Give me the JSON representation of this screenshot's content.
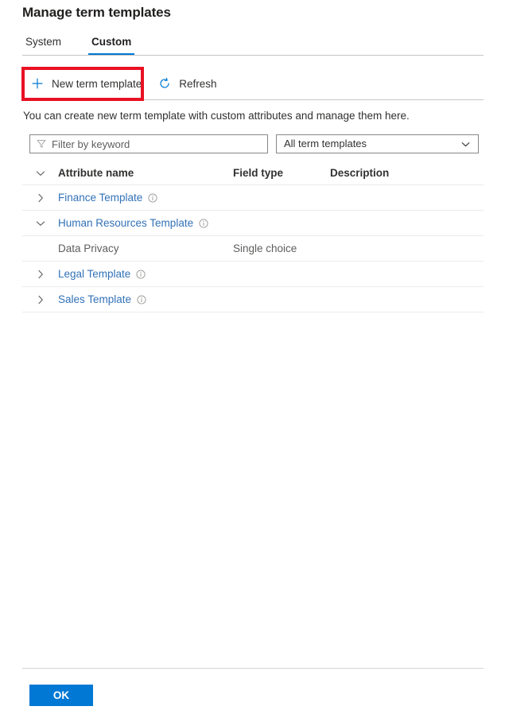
{
  "header": {
    "title": "Manage term templates"
  },
  "tabs": [
    {
      "label": "System",
      "active": false,
      "name": "tab-system"
    },
    {
      "label": "Custom",
      "active": true,
      "name": "tab-custom"
    }
  ],
  "commandbar": {
    "new_template_label": "New term template",
    "new_template_icon": "plus-icon",
    "refresh_label": "Refresh",
    "refresh_icon": "refresh-icon",
    "highlight_color": "#e81123",
    "accent_color": "#0078d4"
  },
  "description": "You can create new term template with custom attributes and manage them here.",
  "filters": {
    "keyword": {
      "value": "",
      "placeholder": "Filter by keyword",
      "icon": "filter-funnel-icon"
    },
    "template_select": {
      "selected": "All term templates",
      "icon": "chevron-down-icon",
      "options": [
        "All term templates"
      ]
    }
  },
  "table": {
    "columns": [
      "Attribute name",
      "Field type",
      "Description"
    ],
    "header_chevron": "chevron-down-icon",
    "rows": [
      {
        "kind": "group",
        "chevron": "chevron-right-icon",
        "expanded": false,
        "name": "Finance Template",
        "info_icon": "info-icon",
        "field_type": "",
        "description": ""
      },
      {
        "kind": "group",
        "chevron": "chevron-down-icon",
        "expanded": true,
        "name": "Human Resources Template",
        "info_icon": "info-icon",
        "field_type": "",
        "description": ""
      },
      {
        "kind": "attribute",
        "chevron": "",
        "name": "Data Privacy",
        "field_type": "Single choice",
        "description": ""
      },
      {
        "kind": "group",
        "chevron": "chevron-right-icon",
        "expanded": false,
        "name": "Legal Template",
        "info_icon": "info-icon",
        "field_type": "",
        "description": ""
      },
      {
        "kind": "group",
        "chevron": "chevron-right-icon",
        "expanded": false,
        "name": "Sales Template",
        "info_icon": "info-icon",
        "field_type": "",
        "description": ""
      }
    ]
  },
  "footer": {
    "ok_label": "OK",
    "ok_color": "#0078d4"
  }
}
